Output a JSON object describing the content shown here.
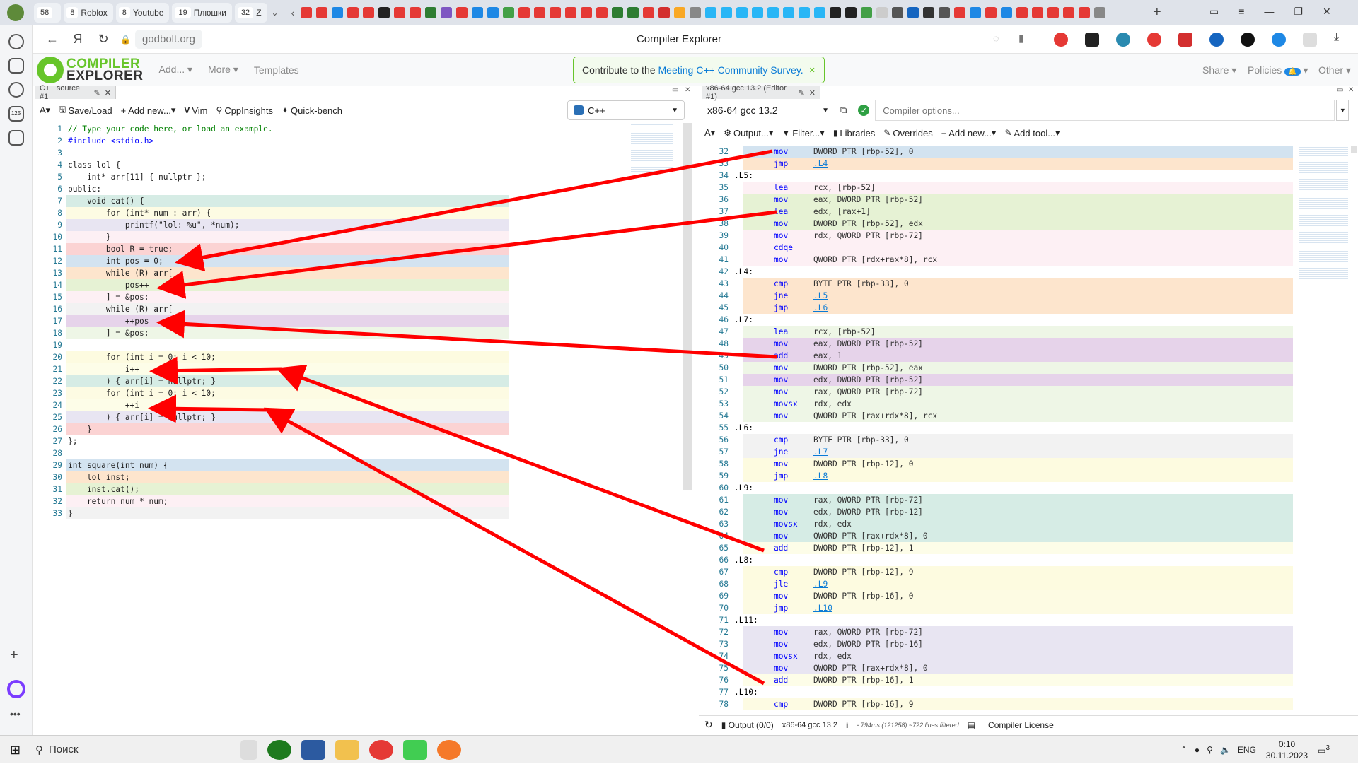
{
  "browser": {
    "tab_groups": [
      {
        "count": "58",
        "label": ""
      },
      {
        "count": "8",
        "label": "Roblox"
      },
      {
        "count": "8",
        "label": "Youtube"
      },
      {
        "count": "19",
        "label": "Плюшки"
      },
      {
        "count": "32",
        "label": "Z"
      }
    ],
    "url": "godbolt.org",
    "page_title": "Compiler Explorer"
  },
  "ce": {
    "logo_line1": "COMPILER",
    "logo_line2": "EXPLORER",
    "menus": [
      "Add...",
      "More",
      "Templates"
    ],
    "survey_prefix": "Contribute to the",
    "survey_link": "Meeting C++ Community Survey.",
    "share": "Share",
    "policies": "Policies",
    "other": "Other"
  },
  "source": {
    "tab": "C++ source #1",
    "toolbar": [
      "Save/Load",
      "+ Add new...",
      "Vim",
      "CppInsights",
      "Quick-bench"
    ],
    "language": "C++",
    "lines": [
      {
        "n": "1",
        "t": "// Type your code here, or load an example.",
        "c": "",
        "k": "cm"
      },
      {
        "n": "2",
        "t": "#include <stdio.h>",
        "c": "",
        "k": "kw"
      },
      {
        "n": "3",
        "t": "",
        "c": "",
        "k": ""
      },
      {
        "n": "4",
        "t": "class lol {",
        "c": "",
        "k": ""
      },
      {
        "n": "5",
        "t": "    int* arr[11] { nullptr };",
        "c": "",
        "k": ""
      },
      {
        "n": "6",
        "t": "public:",
        "c": "",
        "k": ""
      },
      {
        "n": "7",
        "t": "    void cat() {",
        "c": "#d6ece5",
        "k": ""
      },
      {
        "n": "8",
        "t": "        for (int* num : arr) {",
        "c": "#fdfbe3",
        "k": ""
      },
      {
        "n": "9",
        "t": "            printf(\"lol: %u\", *num);",
        "c": "#e8e5f2",
        "k": ""
      },
      {
        "n": "10",
        "t": "        }",
        "c": "#fdf0f4",
        "k": ""
      },
      {
        "n": "11",
        "t": "        bool R = true;",
        "c": "#fbd3d3",
        "k": ""
      },
      {
        "n": "12",
        "t": "        int pos = 0;",
        "c": "#d3e3f0",
        "k": ""
      },
      {
        "n": "13",
        "t": "        while (R) arr[",
        "c": "#fde5cd",
        "k": ""
      },
      {
        "n": "14",
        "t": "            pos++",
        "c": "#e6f2d4",
        "k": ""
      },
      {
        "n": "15",
        "t": "        ] = &pos;",
        "c": "#fdf0f4",
        "k": ""
      },
      {
        "n": "16",
        "t": "        while (R) arr[",
        "c": "#f2f2f2",
        "k": ""
      },
      {
        "n": "17",
        "t": "            ++pos",
        "c": "#e6d3ea",
        "k": ""
      },
      {
        "n": "18",
        "t": "        ] = &pos;",
        "c": "#eef6e6",
        "k": ""
      },
      {
        "n": "19",
        "t": "",
        "c": "",
        "k": ""
      },
      {
        "n": "20",
        "t": "        for (int i = 0; i < 10;",
        "c": "#fdfbe0",
        "k": ""
      },
      {
        "n": "21",
        "t": "            i++",
        "c": "#fdfde8",
        "k": ""
      },
      {
        "n": "22",
        "t": "        ) { arr[i] = nullptr; }",
        "c": "#d6ece5",
        "k": ""
      },
      {
        "n": "23",
        "t": "        for (int i = 0; i < 10;",
        "c": "#fdfbe3",
        "k": ""
      },
      {
        "n": "24",
        "t": "            ++i",
        "c": "#fdfde8",
        "k": ""
      },
      {
        "n": "25",
        "t": "        ) { arr[i] = nullptr; }",
        "c": "#e8e5f2",
        "k": ""
      },
      {
        "n": "26",
        "t": "    }",
        "c": "#fbd3d3",
        "k": ""
      },
      {
        "n": "27",
        "t": "};",
        "c": "",
        "k": ""
      },
      {
        "n": "28",
        "t": "",
        "c": "",
        "k": ""
      },
      {
        "n": "29",
        "t": "int square(int num) {",
        "c": "#d3e3f0",
        "k": ""
      },
      {
        "n": "30",
        "t": "    lol inst;",
        "c": "#fde5cd",
        "k": ""
      },
      {
        "n": "31",
        "t": "    inst.cat();",
        "c": "#e6f2d4",
        "k": ""
      },
      {
        "n": "32",
        "t": "    return num * num;",
        "c": "#fdf0f4",
        "k": ""
      },
      {
        "n": "33",
        "t": "}",
        "c": "#f2f2f2",
        "k": ""
      }
    ]
  },
  "asm": {
    "tab": "x86-64 gcc 13.2 (Editor #1)",
    "compiler": "x86-64 gcc 13.2",
    "options_placeholder": "Compiler options...",
    "toolbar": [
      "Output...",
      "Filter...",
      "Libraries",
      "Overrides",
      "+ Add new...",
      "Add tool..."
    ],
    "lines": [
      {
        "n": "32",
        "i": "mov",
        "o": "DWORD PTR [rbp-52], 0",
        "c": "#d3e3f0"
      },
      {
        "n": "33",
        "i": "jmp",
        "o": ".L4",
        "c": "#fde5cd",
        "link": true
      },
      {
        "n": "34",
        "l": ".L5:"
      },
      {
        "n": "35",
        "i": "lea",
        "o": "rcx, [rbp-52]",
        "c": "#fdf0f4"
      },
      {
        "n": "36",
        "i": "mov",
        "o": "eax, DWORD PTR [rbp-52]",
        "c": "#e6f2d4"
      },
      {
        "n": "37",
        "i": "lea",
        "o": "edx, [rax+1]",
        "c": "#e6f2d4"
      },
      {
        "n": "38",
        "i": "mov",
        "o": "DWORD PTR [rbp-52], edx",
        "c": "#e6f2d4"
      },
      {
        "n": "39",
        "i": "mov",
        "o": "rdx, QWORD PTR [rbp-72]",
        "c": "#fdf0f4"
      },
      {
        "n": "40",
        "i": "cdqe",
        "o": "",
        "c": "#fdf0f4"
      },
      {
        "n": "41",
        "i": "mov",
        "o": "QWORD PTR [rdx+rax*8], rcx",
        "c": "#fdf0f4"
      },
      {
        "n": "42",
        "l": ".L4:"
      },
      {
        "n": "43",
        "i": "cmp",
        "o": "BYTE PTR [rbp-33], 0",
        "c": "#fde5cd"
      },
      {
        "n": "44",
        "i": "jne",
        "o": ".L5",
        "c": "#fde5cd",
        "link": true
      },
      {
        "n": "45",
        "i": "jmp",
        "o": ".L6",
        "c": "#fde5cd",
        "link": true
      },
      {
        "n": "46",
        "l": ".L7:"
      },
      {
        "n": "47",
        "i": "lea",
        "o": "rcx, [rbp-52]",
        "c": "#eef6e6"
      },
      {
        "n": "48",
        "i": "mov",
        "o": "eax, DWORD PTR [rbp-52]",
        "c": "#e6d3ea"
      },
      {
        "n": "49",
        "i": "add",
        "o": "eax, 1",
        "c": "#e6d3ea"
      },
      {
        "n": "50",
        "i": "mov",
        "o": "DWORD PTR [rbp-52], eax",
        "c": "#eef6e6"
      },
      {
        "n": "51",
        "i": "mov",
        "o": "edx, DWORD PTR [rbp-52]",
        "c": "#e6d3ea"
      },
      {
        "n": "52",
        "i": "mov",
        "o": "rax, QWORD PTR [rbp-72]",
        "c": "#eef6e6"
      },
      {
        "n": "53",
        "i": "movsx",
        "o": "rdx, edx",
        "c": "#eef6e6"
      },
      {
        "n": "54",
        "i": "mov",
        "o": "QWORD PTR [rax+rdx*8], rcx",
        "c": "#eef6e6"
      },
      {
        "n": "55",
        "l": ".L6:"
      },
      {
        "n": "56",
        "i": "cmp",
        "o": "BYTE PTR [rbp-33], 0",
        "c": "#f2f2f2"
      },
      {
        "n": "57",
        "i": "jne",
        "o": ".L7",
        "c": "#f2f2f2",
        "link": true
      },
      {
        "n": "58",
        "i": "mov",
        "o": "DWORD PTR [rbp-12], 0",
        "c": "#fdfbe0"
      },
      {
        "n": "59",
        "i": "jmp",
        "o": ".L8",
        "c": "#fdfbe0",
        "link": true
      },
      {
        "n": "60",
        "l": ".L9:"
      },
      {
        "n": "61",
        "i": "mov",
        "o": "rax, QWORD PTR [rbp-72]",
        "c": "#d6ece5"
      },
      {
        "n": "62",
        "i": "mov",
        "o": "edx, DWORD PTR [rbp-12]",
        "c": "#d6ece5"
      },
      {
        "n": "63",
        "i": "movsx",
        "o": "rdx, edx",
        "c": "#d6ece5"
      },
      {
        "n": "64",
        "i": "mov",
        "o": "QWORD PTR [rax+rdx*8], 0",
        "c": "#d6ece5"
      },
      {
        "n": "65",
        "i": "add",
        "o": "DWORD PTR [rbp-12], 1",
        "c": "#fdfde8"
      },
      {
        "n": "66",
        "l": ".L8:"
      },
      {
        "n": "67",
        "i": "cmp",
        "o": "DWORD PTR [rbp-12], 9",
        "c": "#fdfbe0"
      },
      {
        "n": "68",
        "i": "jle",
        "o": ".L9",
        "c": "#fdfbe0",
        "link": true
      },
      {
        "n": "69",
        "i": "mov",
        "o": "DWORD PTR [rbp-16], 0",
        "c": "#fdfbe3"
      },
      {
        "n": "70",
        "i": "jmp",
        "o": ".L10",
        "c": "#fdfbe3",
        "link": true
      },
      {
        "n": "71",
        "l": ".L11:"
      },
      {
        "n": "72",
        "i": "mov",
        "o": "rax, QWORD PTR [rbp-72]",
        "c": "#e8e5f2"
      },
      {
        "n": "73",
        "i": "mov",
        "o": "edx, DWORD PTR [rbp-16]",
        "c": "#e8e5f2"
      },
      {
        "n": "74",
        "i": "movsx",
        "o": "rdx, edx",
        "c": "#e8e5f2"
      },
      {
        "n": "75",
        "i": "mov",
        "o": "QWORD PTR [rax+rdx*8], 0",
        "c": "#e8e5f2"
      },
      {
        "n": "76",
        "i": "add",
        "o": "DWORD PTR [rbp-16], 1",
        "c": "#fdfde8"
      },
      {
        "n": "77",
        "l": ".L10:"
      },
      {
        "n": "78",
        "i": "cmp",
        "o": "DWORD PTR [rbp-16], 9",
        "c": "#fdfbe3"
      }
    ],
    "status": {
      "output": "Output (0/0)",
      "compiler": "x86-64 gcc 13.2",
      "info": "i",
      "timing": "- 794ms (121258) ~722 lines filtered",
      "license": "Compiler License"
    }
  },
  "taskbar": {
    "search": "Поиск",
    "lang": "ENG",
    "time": "0:10",
    "date": "30.11.2023",
    "notif": "3"
  },
  "colors": {
    "accent": "#67c52a",
    "arrow": "#ff0000"
  }
}
